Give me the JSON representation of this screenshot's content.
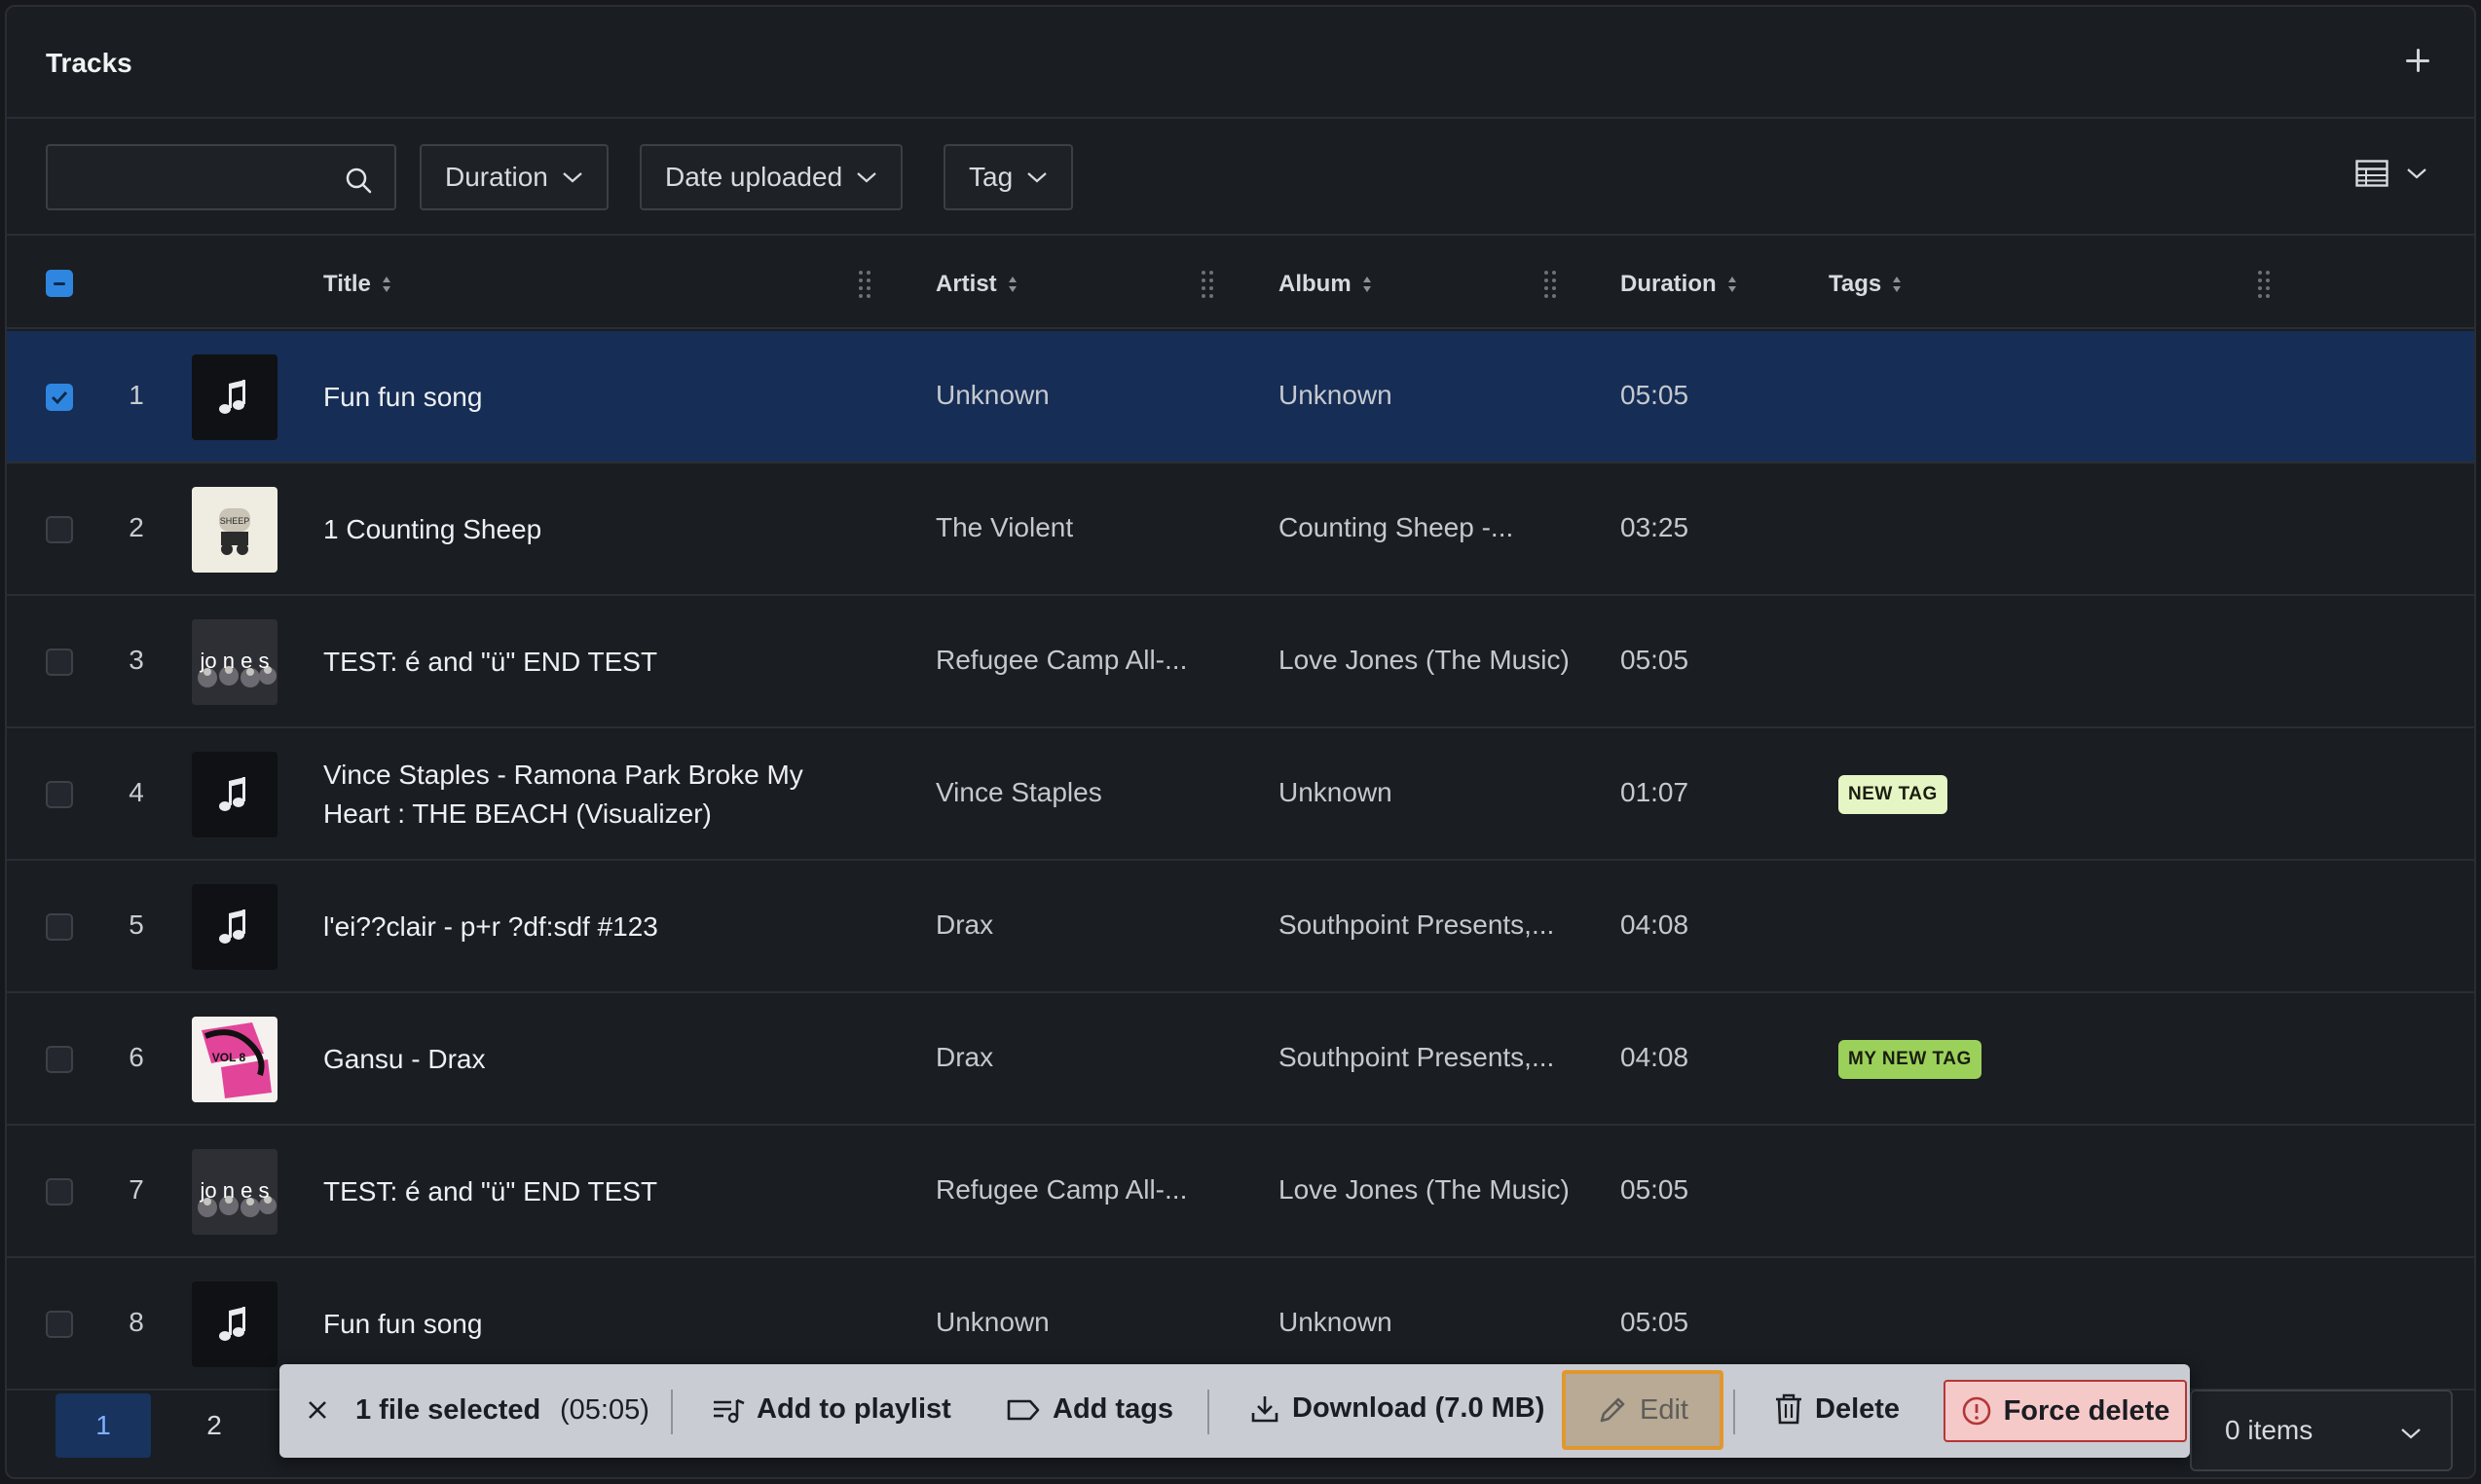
{
  "header": {
    "title": "Tracks"
  },
  "filters": {
    "search_placeholder": "",
    "duration_label": "Duration",
    "date_label": "Date uploaded",
    "tag_label": "Tag"
  },
  "columns": {
    "title": "Title",
    "artist": "Artist",
    "album": "Album",
    "duration": "Duration",
    "tags": "Tags"
  },
  "rows": [
    {
      "num": "1",
      "title": "Fun fun song",
      "artist": "Unknown",
      "album": "Unknown",
      "duration": "05:05",
      "tag": "",
      "thumb": "music",
      "selected": true
    },
    {
      "num": "2",
      "title": "1 Counting Sheep",
      "artist": "The Violent",
      "album": "Counting Sheep -...",
      "duration": "03:25",
      "tag": "",
      "thumb": "sheep",
      "selected": false
    },
    {
      "num": "3",
      "title": "TEST: é and \"ü\" END TEST",
      "artist": "Refugee Camp All-...",
      "album": "Love Jones (The Music)",
      "duration": "05:05",
      "tag": "",
      "thumb": "jones",
      "selected": false
    },
    {
      "num": "4",
      "title": "Vince Staples - Ramona Park Broke My Heart : THE BEACH (Visualizer)",
      "artist": "Vince Staples",
      "album": "Unknown",
      "duration": "01:07",
      "tag": "NEW TAG",
      "thumb": "music",
      "selected": false
    },
    {
      "num": "5",
      "title": "l'ei??clair - p+r ?df:sdf #123",
      "artist": "Drax",
      "album": "Southpoint Presents,...",
      "duration": "04:08",
      "tag": "",
      "thumb": "music",
      "selected": false
    },
    {
      "num": "6",
      "title": "Gansu - Drax",
      "artist": "Drax",
      "album": "Southpoint Presents,...",
      "duration": "04:08",
      "tag": "MY NEW TAG",
      "thumb": "vol8",
      "selected": false
    },
    {
      "num": "7",
      "title": "TEST: é and \"ü\" END TEST",
      "artist": "Refugee Camp All-...",
      "album": "Love Jones (The Music)",
      "duration": "05:05",
      "tag": "",
      "thumb": "jones",
      "selected": false
    },
    {
      "num": "8",
      "title": "Fun fun song",
      "artist": "Unknown",
      "album": "Unknown",
      "duration": "05:05",
      "tag": "",
      "thumb": "music",
      "selected": false
    }
  ],
  "thumb_text": {
    "jones": "jo n e s",
    "sheep": "SHEEP",
    "vol8": "VOL 8"
  },
  "tag_colors": {
    "NEW TAG": "#e6f5c4",
    "MY NEW TAG": "#9bd15a"
  },
  "pagination": {
    "pages": [
      "1",
      "2"
    ],
    "current": "1",
    "items_label": "0 items"
  },
  "actionbar": {
    "selected": "1 file selected",
    "total_duration": "(05:05)",
    "add_playlist": "Add to playlist",
    "add_tags": "Add tags",
    "download": "Download (7.0 MB)",
    "edit": "Edit",
    "delete": "Delete",
    "force_delete": "Force delete"
  },
  "colors": {
    "selected_row": "#162d55",
    "accent": "#2f86e0",
    "danger": "#b53636"
  }
}
